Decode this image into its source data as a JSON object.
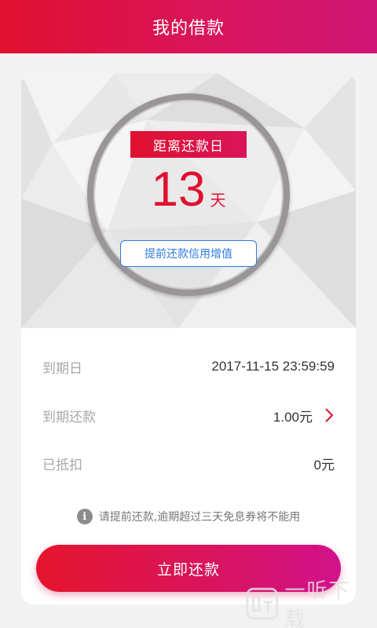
{
  "header": {
    "title": "我的借款"
  },
  "hero": {
    "label": "距离还款日",
    "days_value": "13",
    "days_unit": "天",
    "boost_button": "提前还款信用增值"
  },
  "details": {
    "due_date_label": "到期日",
    "due_date_value": "2017-11-15 23:59:59",
    "due_amount_label": "到期还款",
    "due_amount_value": "1.00元",
    "deducted_label": "已抵扣",
    "deducted_value": "0元"
  },
  "notice": {
    "icon": "info-icon",
    "text": "请提前还款,逾期超过三天免息券将不能用"
  },
  "repay_button": {
    "label": "立即还款"
  },
  "watermark": {
    "text": "一听下载"
  },
  "colors": {
    "brand_red": "#e0102f",
    "brand_magenta": "#d01576",
    "link_blue": "#2d7be0"
  }
}
